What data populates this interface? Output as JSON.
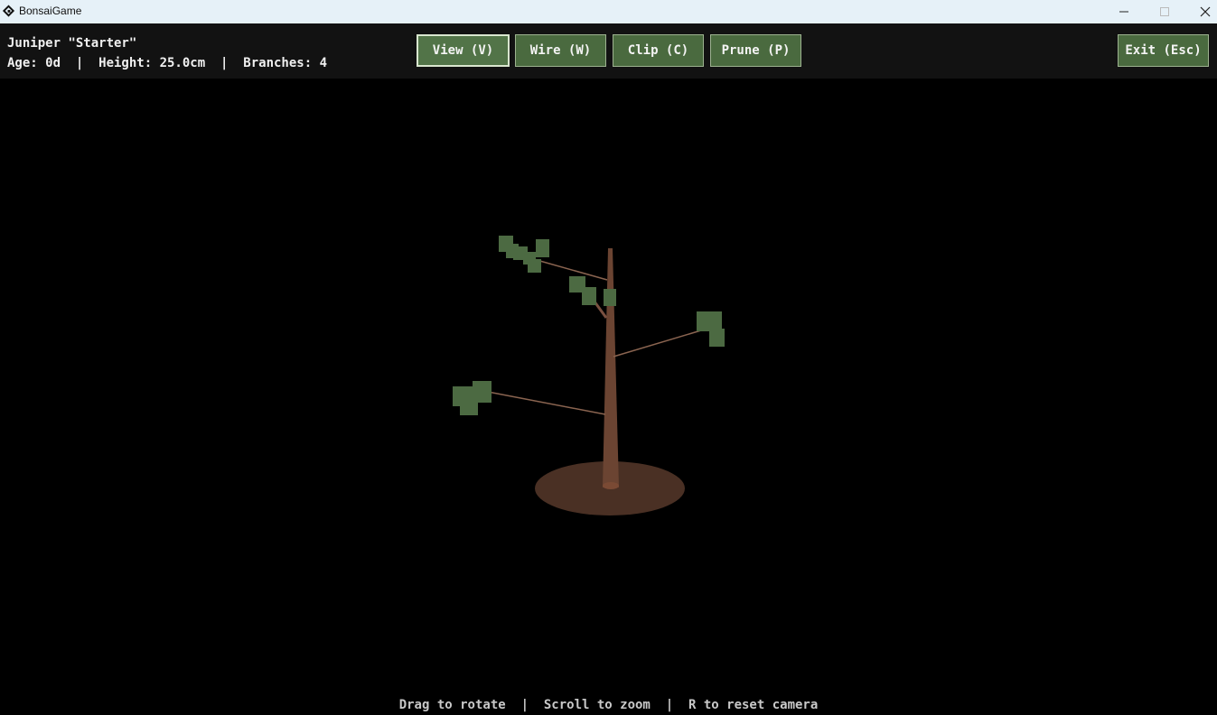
{
  "window": {
    "title": "BonsaiGame"
  },
  "hud": {
    "tree_name": "Juniper \"Starter\"",
    "stats": "Age: 0d  |  Height: 25.0cm  |  Branches: 4",
    "tools": [
      {
        "label": "View (V)",
        "active": true
      },
      {
        "label": "Wire (W)",
        "active": false
      },
      {
        "label": "Clip (C)",
        "active": false
      },
      {
        "label": "Prune (P)",
        "active": false
      }
    ],
    "exit_label": "Exit (Esc)"
  },
  "scene": {
    "background": "#000000",
    "pot_color": "#4a3024",
    "trunk_color": "#6b4432",
    "foliage_color": "#4c6a42",
    "branch_color": "#8a6450"
  },
  "footer": {
    "hint": "Drag to rotate  |  Scroll to zoom  |  R to reset camera"
  }
}
